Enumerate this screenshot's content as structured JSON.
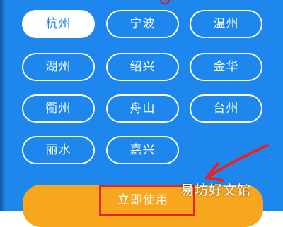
{
  "cities": [
    {
      "label": "杭州",
      "selected": true
    },
    {
      "label": "宁波",
      "selected": false
    },
    {
      "label": "温州",
      "selected": false
    },
    {
      "label": "湖州",
      "selected": false
    },
    {
      "label": "绍兴",
      "selected": false
    },
    {
      "label": "金华",
      "selected": false
    },
    {
      "label": "衢州",
      "selected": false
    },
    {
      "label": "舟山",
      "selected": false
    },
    {
      "label": "台州",
      "selected": false
    },
    {
      "label": "丽水",
      "selected": false
    },
    {
      "label": "嘉兴",
      "selected": false
    }
  ],
  "action": {
    "use_label": "立即使用"
  },
  "watermark": "易坊好文馆",
  "colors": {
    "background": "#1e87ee",
    "button": "#f8a61e",
    "annotation": "#e52524"
  }
}
